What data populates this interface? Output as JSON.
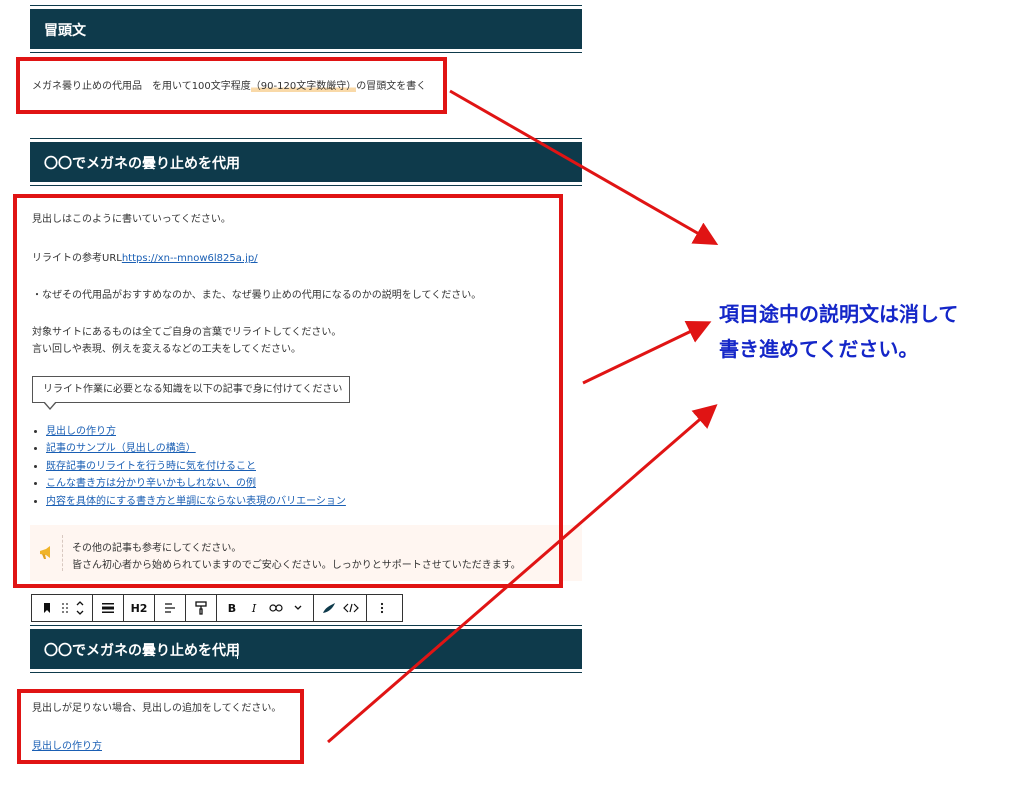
{
  "section1": {
    "heading": "冒頭文",
    "instruction": {
      "pre": "メガネ曇り止めの代用品　を用いて100文字程度",
      "highlight": "（90-120文字数厳守）",
      "post": "の冒頭文を書く"
    }
  },
  "section2": {
    "heading": "〇〇でメガネの曇り止めを代用",
    "line1": "見出しはこのように書いていってください。",
    "ref_label": "リライトの参考URL",
    "ref_url": "https://xn--mnow6l825a.jp/",
    "line3": "・なぜその代用品がおすすめなのか、また、なぜ曇り止めの代用になるのかの説明をしてください。",
    "line4": "対象サイトにあるものは全てご自身の言葉でリライトしてください。",
    "line5": "言い回しや表現、例えを変えるなどの工夫をしてください。",
    "balloon": "リライト作業に必要となる知識を以下の記事で身に付けてください",
    "links": [
      "見出しの作り方",
      "記事のサンプル（見出しの構造）",
      "既存記事のリライトを行う時に気を付けること",
      "こんな書き方は分かり辛いかもしれない、の例",
      "内容を具体的にする書き方と単調にならない表現のバリエーション"
    ],
    "notice_line1": "その他の記事も参考にしてください。",
    "notice_line2": "皆さん初心者から始められていますのでご安心ください。しっかりとサポートさせていただきます。"
  },
  "toolbar": {
    "heading_level": "H2",
    "bold": "B",
    "italic": "I"
  },
  "section3": {
    "heading": "〇〇でメガネの曇り止めを代用",
    "line1": "見出しが足りない場合、見出しの追加をしてください。",
    "link": "見出しの作り方"
  },
  "annotation": {
    "line1": "項目途中の説明文は消して",
    "line2": "書き進めてください。"
  },
  "colors": {
    "heading_bg": "#0e3a4b",
    "annotation_box": "#e01414",
    "annotation_text": "#1426c8",
    "link": "#1a5fb4"
  }
}
